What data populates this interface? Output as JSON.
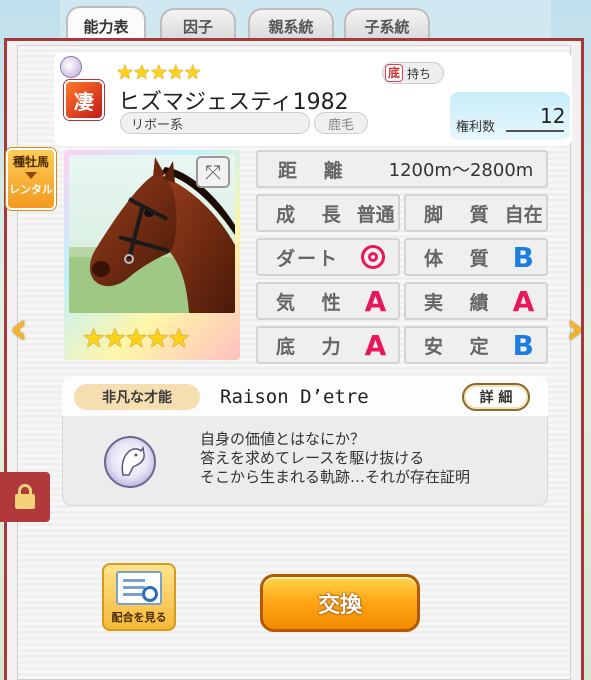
{
  "tabs": [
    "能力表",
    "因子",
    "親系統",
    "子系統"
  ],
  "header": {
    "stars": "★★★★★",
    "trait_kanji": "底",
    "trait_label": "持ち",
    "rank_kanji": "凄",
    "horse_name": "ヒズマジェスティ1982",
    "lineage": "リボー系",
    "coat_color": "鹿毛",
    "rights_label": "権利数",
    "rights_value": "12"
  },
  "stallion_tag": {
    "line1": "種牡馬",
    "line2": "レンタル"
  },
  "portrait": {
    "stars": "★★★★★",
    "expand_icon": "expand-icon"
  },
  "stats": {
    "distance_label": "距 離",
    "distance_value": "1200m〜2800m",
    "growth_label": "成 長",
    "growth_value": "普通",
    "leg_label": "脚 質",
    "leg_value": "自在",
    "dirt_label": "ダート",
    "dirt_value": "◎",
    "body_label": "体 質",
    "body_value": "B",
    "temper_label": "気 性",
    "temper_value": "A",
    "record_label": "実 績",
    "record_value": "A",
    "power_label": "底 力",
    "power_value": "A",
    "stability_label": "安 定",
    "stability_value": "B"
  },
  "skill": {
    "tag": "非凡な才能",
    "name": "Raison D’etre",
    "detail_button": "詳 細",
    "desc_line1": "自身の価値とはなにか？",
    "desc_line2": "答えを求めてレースを駆け抜ける",
    "desc_line3": "そこから生まれる軌跡…それが存在証明"
  },
  "buttons": {
    "breeding": "配合を見る",
    "exchange": "交換"
  },
  "colors": {
    "grade_A": "#e8175d",
    "grade_B": "#1b7de0",
    "panel_border": "#a63a3a",
    "exchange_button": "#ffa515"
  }
}
